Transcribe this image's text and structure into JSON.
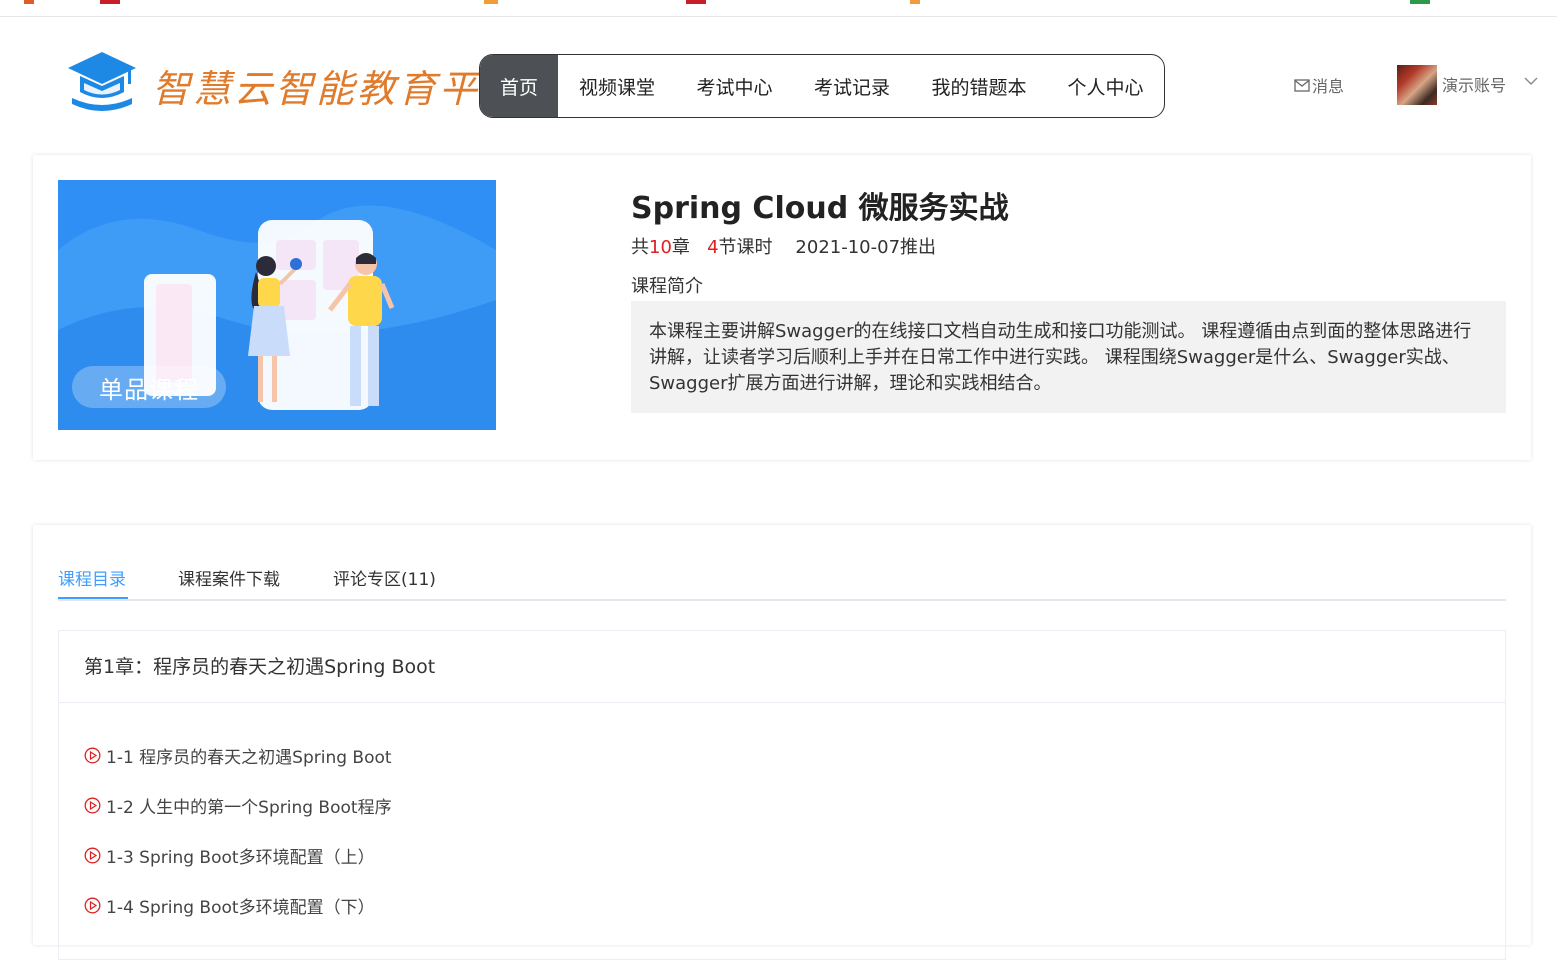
{
  "header": {
    "logo_text": "智慧云智能教育平台",
    "nav": [
      {
        "label": "首页",
        "active": true
      },
      {
        "label": "视频课堂",
        "active": false
      },
      {
        "label": "考试中心",
        "active": false
      },
      {
        "label": "考试记录",
        "active": false
      },
      {
        "label": "我的错题本",
        "active": false
      },
      {
        "label": "个人中心",
        "active": false
      }
    ],
    "messages_label": "消息",
    "user_name": "演示账号"
  },
  "course": {
    "cover_badge": "单品课程",
    "title": "Spring Cloud 微服务实战",
    "meta": {
      "prefix": "共",
      "chapters": "10",
      "chapters_unit": "章",
      "lessons": "4",
      "lessons_unit": "节课时",
      "release": "2021-10-07推出"
    },
    "intro_label": "课程简介",
    "intro_text": "本课程主要讲解Swagger的在线接口文档自动生成和接口功能测试。 课程遵循由点到面的整体思路进行讲解，让读者学习后顺利上手并在日常工作中进行实践。 课程围绕Swagger是什么、Swagger实战、Swagger扩展方面进行讲解，理论和实践相结合。"
  },
  "tabs": [
    {
      "label": "课程目录",
      "active": true
    },
    {
      "label": "课程案件下载",
      "active": false
    },
    {
      "label": "评论专区(11)",
      "active": false
    }
  ],
  "chapter": {
    "title": "第1章：程序员的春天之初遇Spring Boot",
    "lessons": [
      "1-1 程序员的春天之初遇Spring Boot",
      "1-2 人生中的第一个Spring Boot程序",
      "1-3 Spring Boot多环境配置（上）",
      "1-4 Spring Boot多环境配置（下）"
    ]
  },
  "colors": {
    "accent": "#409eff",
    "nav_active_bg": "#4d5055",
    "highlight_red": "#e02020",
    "logo_orange": "#e07b2c",
    "logo_blue": "#1e88e5"
  }
}
